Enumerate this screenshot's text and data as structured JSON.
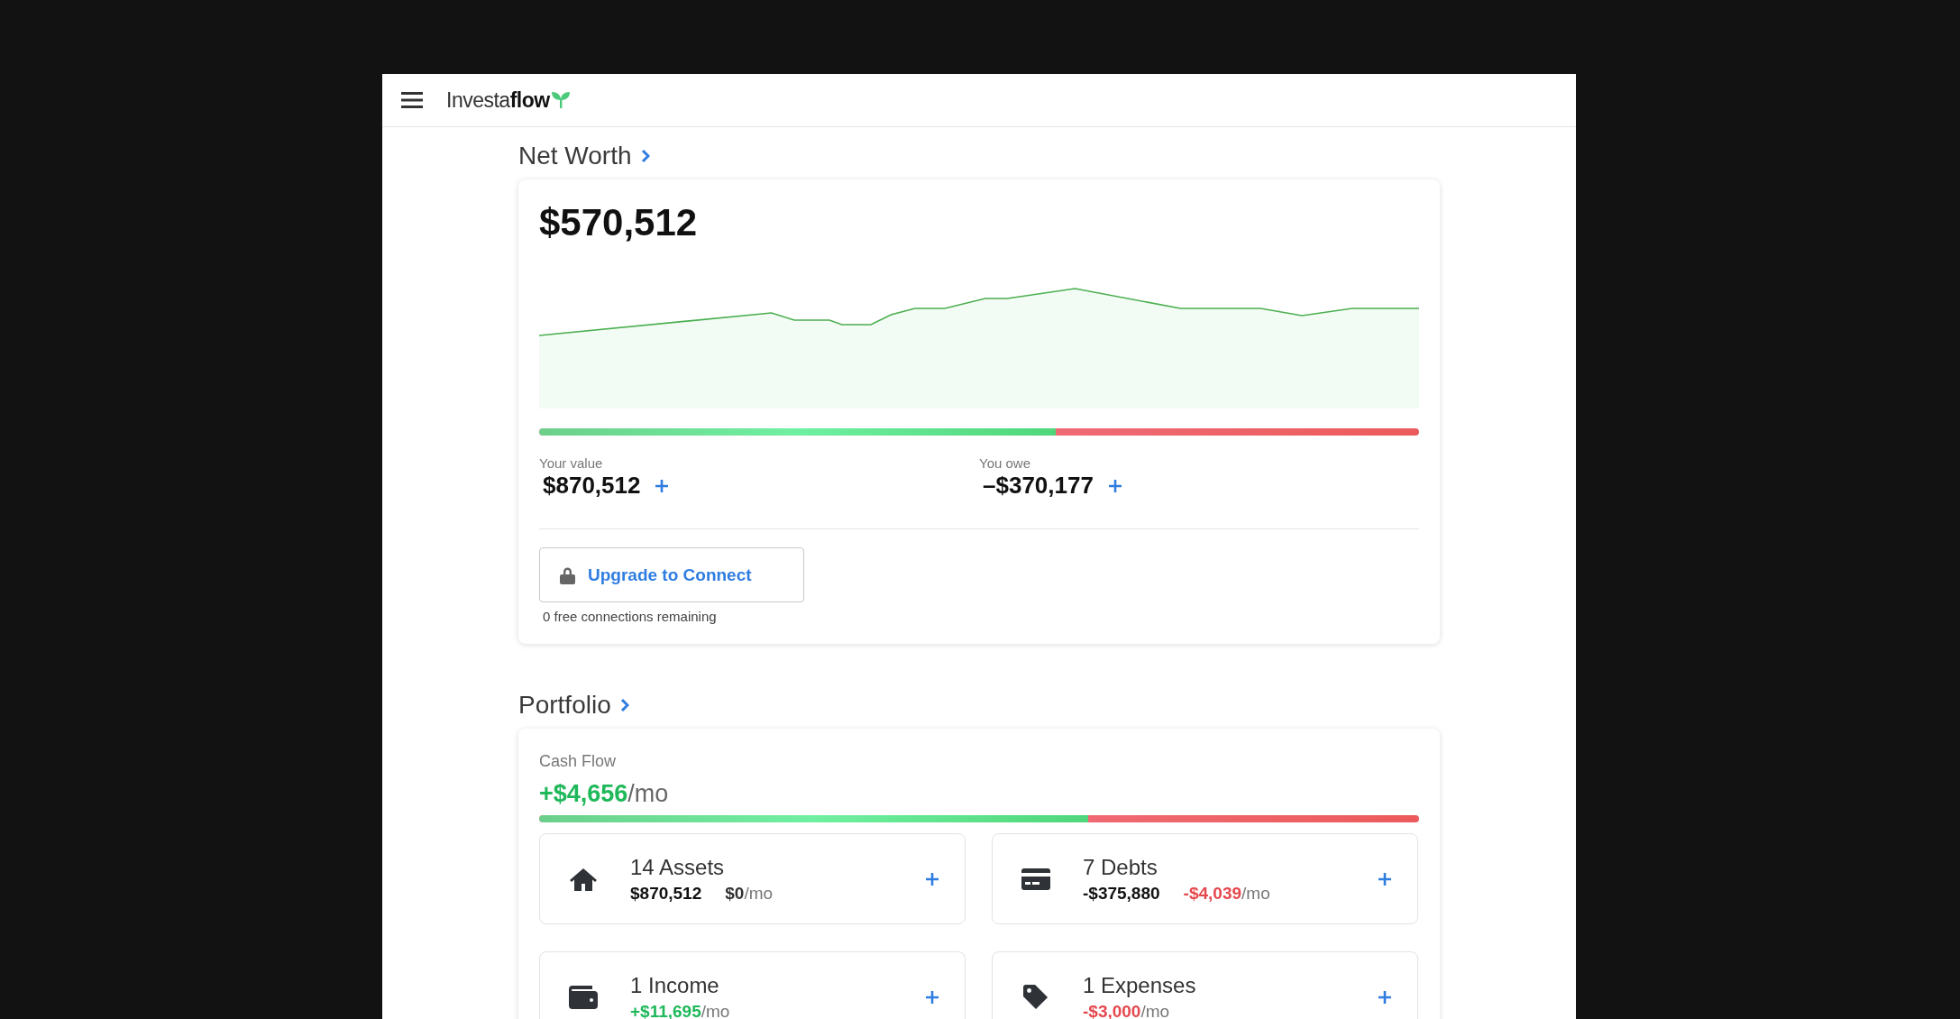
{
  "header": {
    "logo": "Investa**flow**"
  },
  "net_worth": {
    "title": "Net Worth",
    "total": "$570,512",
    "level": 0.587,
    "value": {
      "label": "Your value",
      "amount": "$870,512"
    },
    "owe": {
      "label": "You owe",
      "amount": "–$370,177"
    },
    "upgrade_button": "Upgrade to Connect",
    "connections_note": "0 free connections remaining"
  },
  "portfolio": {
    "title": "Portfolio",
    "cash_flow": {
      "label": "Cash Flow",
      "amount": "+$4,656",
      "unit": "/mo",
      "level": 0.624
    },
    "categories": [
      {
        "kind": "assets",
        "title": "14 Assets",
        "amount": "$870,512",
        "monthly": "$0",
        "unit": "/mo",
        "color": "#333333"
      },
      {
        "kind": "debts",
        "title": "7 Debts",
        "amount": "-$375,880",
        "monthly": "-$4,039",
        "unit": "/mo",
        "color": "#e5484d"
      },
      {
        "kind": "income",
        "title": "1 Income",
        "monthly": "+$11,695",
        "unit": "/mo",
        "color": "#1fb85a"
      },
      {
        "kind": "expenses",
        "title": "1 Expenses",
        "monthly": "-$3,000",
        "unit": "/mo",
        "color": "#e5484d"
      }
    ]
  }
}
